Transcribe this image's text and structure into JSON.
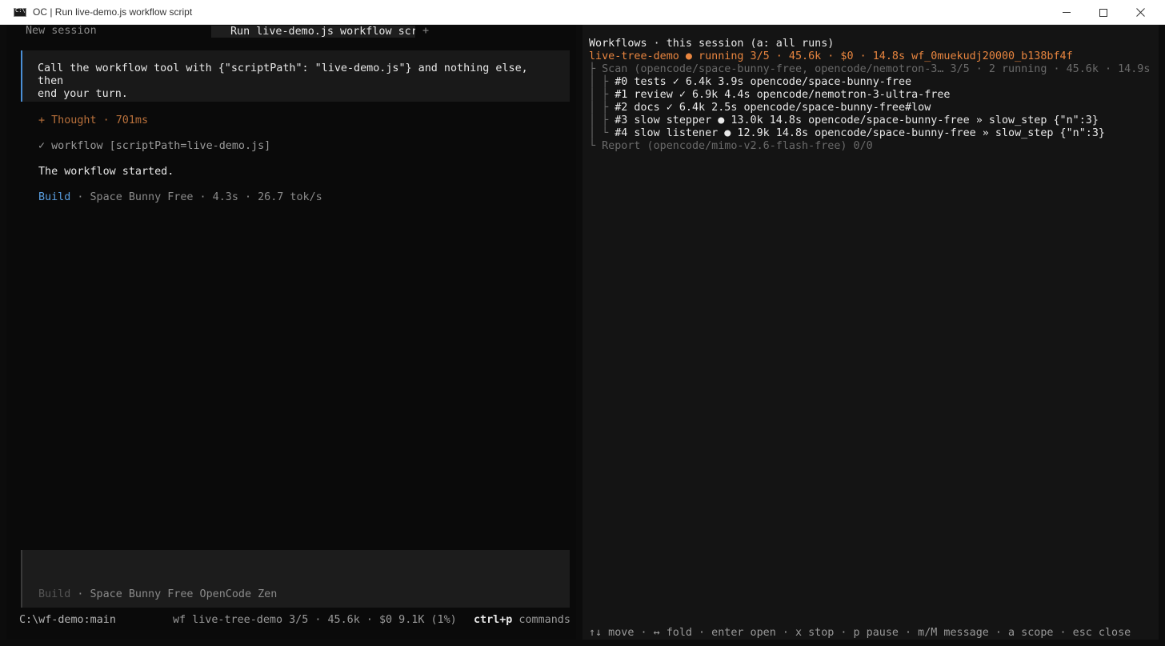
{
  "window": {
    "icon_text": "C:\\",
    "title": "OC | Run live-demo.js workflow script"
  },
  "tabs": {
    "new_session": "New session",
    "active": "Run live-demo.js workflow script",
    "plus": "+"
  },
  "chat": {
    "prompt_line1": "Call the workflow tool with {\"scriptPath\": \"live-demo.js\"} and nothing else, then",
    "prompt_line2": "end your turn.",
    "thought": "+ Thought · 701ms",
    "tool_call": "✓ workflow [scriptPath=live-demo.js]",
    "result": "The workflow started.",
    "build_agent": "Build",
    "build_meta": " · Space Bunny Free · 4.3s · 26.7 tok/s"
  },
  "input": {
    "agent": "Build",
    "meta": " · Space Bunny Free OpenCode Zen"
  },
  "statusbar": {
    "path": "C:\\wf-demo:main",
    "workflow": "wf live-tree-demo 3/5 · 45.6k · $0  9.1K (1%)",
    "shortcut": "ctrl+p",
    "shortcut_label": " commands"
  },
  "workflows": {
    "header": "Workflows · this session (a: all runs)",
    "run_line": "live-tree-demo  ● running  3/5 · 45.6k · $0 · 14.8s  wf_0muekudj20000_b138bf4f",
    "scan_line": "├ Scan (opencode/space-bunny-free, opencode/nemotron-3…  3/5 · 2 running · 45.6k · 14.9s",
    "steps": [
      {
        "tree": "│ ├",
        "text": " #0 tests  ✓ 6.4k 3.9s  opencode/space-bunny-free"
      },
      {
        "tree": "│ ├",
        "text": " #1 review  ✓ 6.9k 4.4s  opencode/nemotron-3-ultra-free"
      },
      {
        "tree": "│ ├",
        "text": " #2 docs  ✓ 6.4k 2.5s  opencode/space-bunny-free#low"
      },
      {
        "tree": "│ ├",
        "text": " #3 slow stepper  ● 13.0k 14.8s  opencode/space-bunny-free  » slow_step {\"n\":3}"
      },
      {
        "tree": "│ └",
        "text": " #4 slow listener  ● 12.9k 14.8s  opencode/space-bunny-free  » slow_step {\"n\":3}"
      }
    ],
    "report_line": "└ Report (opencode/mimo-v2.6-flash-free)  0/0",
    "footer": "↑↓ move · ↔ fold · enter open · x stop · p pause · m/M message · a scope · esc close"
  },
  "colors": {
    "accent_blue": "#4a8fd6",
    "running_orange": "#e8853f",
    "thought_orange": "#b8703b"
  }
}
